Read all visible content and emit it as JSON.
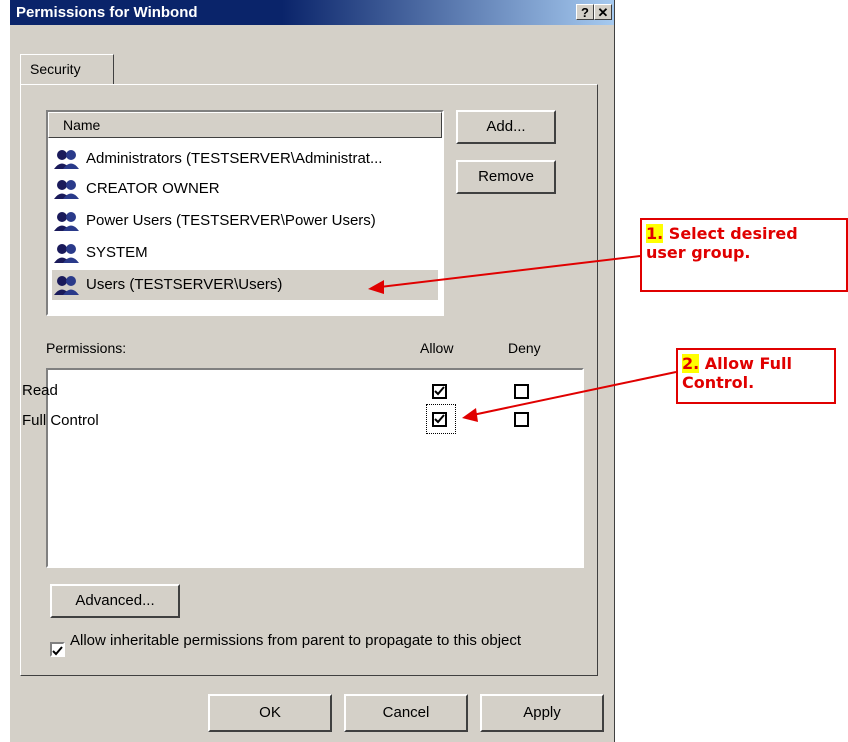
{
  "window": {
    "title": "Permissions for Winbond",
    "help_btn": "?",
    "close_btn": "✕"
  },
  "tab": {
    "label": "Security"
  },
  "users": {
    "column_header": "Name",
    "items": [
      {
        "label": "Administrators (TESTSERVER\\Administrat..."
      },
      {
        "label": "CREATOR OWNER"
      },
      {
        "label": "Power Users (TESTSERVER\\Power Users)"
      },
      {
        "label": "SYSTEM"
      },
      {
        "label": "Users (TESTSERVER\\Users)",
        "selected": true
      }
    ],
    "add_label": "Add...",
    "remove_label": "Remove"
  },
  "permissions": {
    "label": "Permissions:",
    "allow_label": "Allow",
    "deny_label": "Deny",
    "items": [
      {
        "label": "Read",
        "allow": true,
        "deny": false
      },
      {
        "label": "Full Control",
        "allow": true,
        "deny": false
      }
    ]
  },
  "advanced_label": "Advanced...",
  "inherit": {
    "label": "Allow inheritable permissions from parent to propagate to this object",
    "checked": true
  },
  "footer": {
    "ok": "OK",
    "cancel": "Cancel",
    "apply": "Apply"
  },
  "callouts": [
    {
      "number": "1.",
      "text1": "Select desired",
      "text2": "user group."
    },
    {
      "number": "2.",
      "text1": "Allow Full",
      "text2": "Control."
    }
  ],
  "colors": {
    "annotation": "#e00000",
    "highlight": "#ffff00",
    "titlebar": "#0a246a",
    "face": "#d4d0c8"
  }
}
